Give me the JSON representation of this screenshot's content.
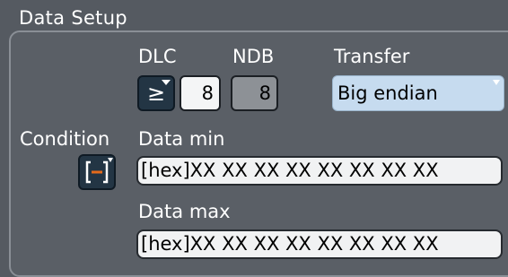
{
  "dialog": {
    "title": "Data Setup"
  },
  "dlc": {
    "label": "DLC",
    "operator_symbol": "≥",
    "value": "8"
  },
  "ndb": {
    "label": "NDB",
    "value": "8"
  },
  "transfer": {
    "label": "Transfer",
    "selected": "Big endian"
  },
  "condition": {
    "label": "Condition",
    "icon": "range-bracket-icon"
  },
  "data_min": {
    "label": "Data min",
    "value": "[hex]XX XX XX XX XX XX XX XX"
  },
  "data_max": {
    "label": "Data max",
    "value": "[hex]XX XX XX XX XX XX XX XX"
  },
  "colors": {
    "background": "#555a61",
    "operator_button": "#233544",
    "dropdown": "#c6dbef",
    "condition_accent": "#e46a1b"
  }
}
